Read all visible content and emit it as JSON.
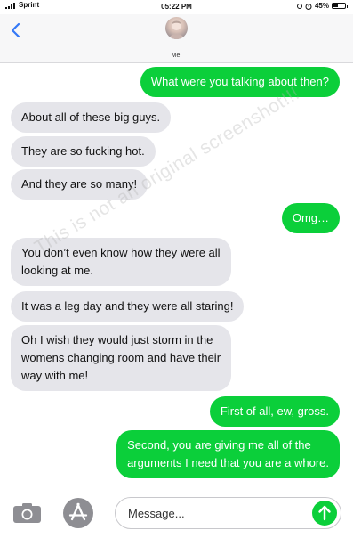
{
  "status_bar": {
    "carrier": "Sprint",
    "time": "05:22 PM",
    "battery": "45%",
    "battery_level": 0.45
  },
  "header": {
    "contact_name": "Me!"
  },
  "messages": [
    {
      "direction": "out",
      "text": "What were you talking about then?"
    },
    {
      "direction": "in",
      "text": "About all of these big guys."
    },
    {
      "direction": "in",
      "text": "They are so fucking hot."
    },
    {
      "direction": "in",
      "text": "And they are so many!"
    },
    {
      "direction": "out",
      "text": "Omg…"
    },
    {
      "direction": "in",
      "lines": [
        "You don’t even know how they were all",
        "looking at me."
      ]
    },
    {
      "direction": "in",
      "text": "It was a leg day and they were all staring!"
    },
    {
      "direction": "in",
      "lines": [
        "Oh I wish they would just storm in the",
        "womens changing room and have their",
        "way with me!"
      ]
    },
    {
      "direction": "out",
      "text": "First of all, ew, gross."
    },
    {
      "direction": "out",
      "lines": [
        "Second, you are giving me all of the",
        "arguments I need that you are a whore."
      ]
    }
  ],
  "watermark": "This is not an original screenshot!!!",
  "input": {
    "placeholder": "Message..."
  },
  "icons": {
    "back": "chevron-left-icon",
    "camera": "camera-icon",
    "apps": "app-store-icon",
    "send": "arrow-up-icon"
  },
  "colors": {
    "outgoing": "#0bcf3a",
    "incoming": "#e5e5ea",
    "accent": "#3478f6"
  }
}
